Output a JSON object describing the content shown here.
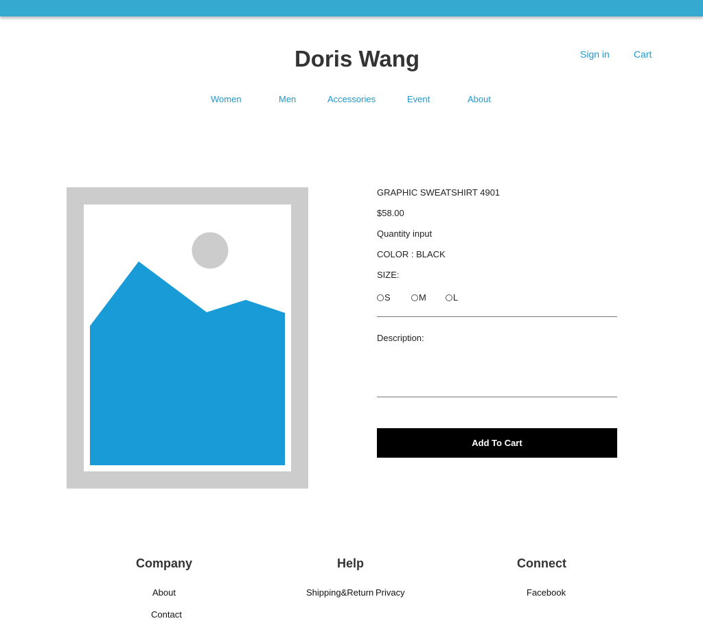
{
  "brand": "Doris Wang",
  "account": {
    "sign_in": "Sign in",
    "cart": "Cart"
  },
  "nav": [
    "Women",
    "Men",
    "Accessories",
    "Event",
    "About"
  ],
  "product": {
    "name": "GRAPHIC SWEATSHIRT 4901",
    "price": "$58.00",
    "quantity_label": "Quantity input",
    "color_label": "COLOR : BLACK",
    "size_label": "SIZE:",
    "sizes": [
      "S",
      "M",
      "L"
    ],
    "description_label": "Description:",
    "add_to_cart": "Add To Cart",
    "image_icon": "image-placeholder-icon"
  },
  "footer": {
    "company": {
      "title": "Company",
      "links": [
        "About",
        "Contact"
      ]
    },
    "help": {
      "title": "Help",
      "links": [
        "Shipping&Return",
        "Privacy"
      ]
    },
    "connect": {
      "title": "Connect",
      "links": [
        "Facebook"
      ]
    }
  },
  "colors": {
    "top_bar": "#36a9d1",
    "link": "#1f98cc",
    "image_blue": "#189bd6",
    "button": "#000000"
  }
}
